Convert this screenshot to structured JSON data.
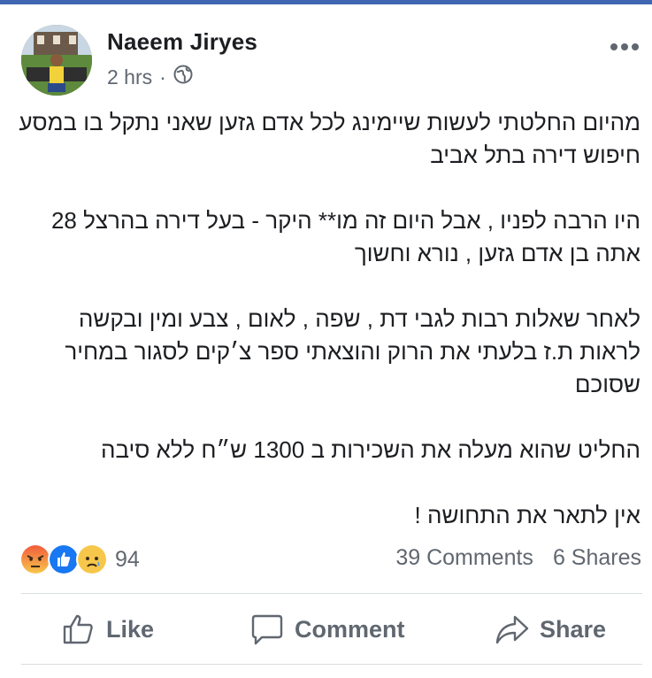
{
  "post": {
    "author": "Naeem Jiryes",
    "time": "2 hrs",
    "separator": "·",
    "privacy_icon": "globe-icon",
    "paragraphs": [
      [
        "מהיום החלטתי לעשות שיימינג לכל אדם גזען שאני נתקל בו במסע",
        "חיפוש דירה בתל אביב"
      ],
      [
        "היו הרבה לפניו , אבל היום זה מו** היקר - בעל דירה בהרצל 28",
        "אתה בן אדם גזען , נורא וחשוך"
      ],
      [
        "לאחר שאלות רבות לגבי דת , שפה , לאום , צבע ומין ובקשה",
        "לראות ת.ז בלעתי את הרוק והוצאתי ספר צ׳קים לסגור במחיר",
        "שסוכם"
      ],
      [
        "החליט שהוא מעלה את השכירות ב 1300 ש״ח ללא סיבה"
      ],
      [
        "אין לתאר את התחושה !"
      ]
    ]
  },
  "reactions": {
    "icons": [
      "angry-reaction-icon",
      "like-reaction-icon",
      "sad-reaction-icon"
    ],
    "count": "94",
    "colors": {
      "angry": "#f7714b",
      "like": "#1877f2",
      "sad": "#f7c74b"
    }
  },
  "stats": {
    "comments": "39 Comments",
    "shares": "6 Shares"
  },
  "actions": {
    "like": "Like",
    "comment": "Comment",
    "share": "Share"
  },
  "colors": {
    "accent": "#4267b2",
    "secondary_text": "#606770",
    "divider": "#dadde1"
  }
}
